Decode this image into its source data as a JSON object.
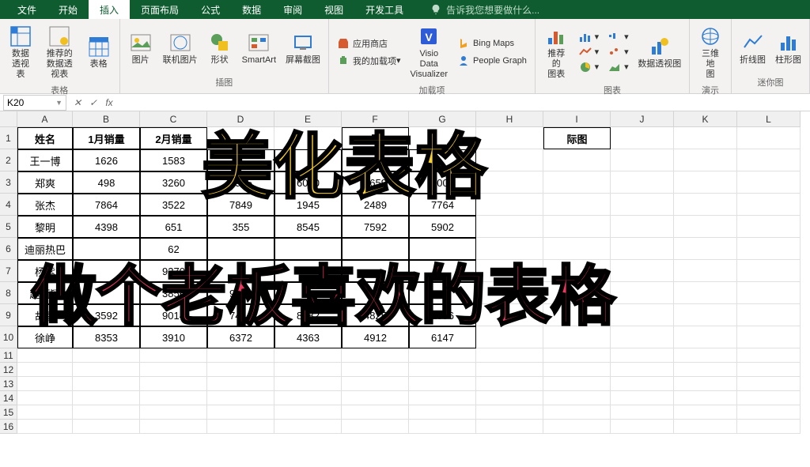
{
  "menu": {
    "file": "文件",
    "home": "开始",
    "insert": "插入",
    "pageLayout": "页面布局",
    "formulas": "公式",
    "data": "数据",
    "review": "审阅",
    "view": "视图",
    "developer": "开发工具",
    "tellMe": "告诉我您想要做什么..."
  },
  "ribbon": {
    "group_tables": "表格",
    "pivotTable": "数据\n透视表",
    "recommendedPivot": "推荐的\n数据透视表",
    "table": "表格",
    "group_illustrations": "插图",
    "picture": "图片",
    "onlinePictures": "联机图片",
    "shapes": "形状",
    "smartArt": "SmartArt",
    "screenshot": "屏幕截图",
    "group_addins": "加载项",
    "store": "应用商店",
    "myAddins": "我的加载项",
    "visioData": "Visio Data\nVisualizer",
    "bingMaps": "Bing Maps",
    "peopleGraph": "People Graph",
    "group_charts": "图表",
    "recommendedCharts": "推荐的\n图表",
    "pivotChart": "数据透视图",
    "group_tours": "演示",
    "map3d": "三维地\n图",
    "group_sparklines": "迷你图",
    "line": "折线图",
    "column": "柱形图"
  },
  "nameBox": "K20",
  "columns": [
    "A",
    "B",
    "C",
    "D",
    "E",
    "F",
    "G",
    "H",
    "I",
    "J",
    "K",
    "L"
  ],
  "colWidths": [
    "col-A",
    "col-B",
    "col-C",
    "col-D",
    "col-E",
    "col-F",
    "col-G",
    "col-H",
    "col-I",
    "col-J",
    "col-K",
    "col-L"
  ],
  "tableHeaders": [
    "姓名",
    "1月销量",
    "2月销量",
    "",
    "",
    "量",
    "",
    "",
    "际图"
  ],
  "tableData": [
    [
      "王一博",
      "1626",
      "1583",
      "",
      "",
      "",
      "",
      "",
      ""
    ],
    [
      "郑爽",
      "498",
      "3260",
      "7965",
      "6030",
      "9659",
      "9004",
      "",
      ""
    ],
    [
      "张杰",
      "7864",
      "3522",
      "7849",
      "1945",
      "2489",
      "7764",
      "",
      ""
    ],
    [
      "黎明",
      "4398",
      "651",
      "355",
      "8545",
      "7592",
      "5902",
      "",
      ""
    ],
    [
      "迪丽热巴",
      "",
      "62",
      "",
      "",
      "",
      "",
      "",
      ""
    ],
    [
      "杨紫",
      "",
      "9270",
      "3",
      "",
      "",
      "",
      "",
      ""
    ],
    [
      "赵丽颖",
      "",
      "3856",
      "9490",
      "",
      "",
      "",
      "",
      ""
    ],
    [
      "胡歌",
      "3592",
      "9014",
      "7444",
      "8082",
      "4825",
      "1096",
      "",
      ""
    ],
    [
      "徐峥",
      "8353",
      "3910",
      "6372",
      "4363",
      "4912",
      "6147",
      "",
      ""
    ]
  ],
  "overlay1": "美化表格",
  "overlay2": "做个老板喜欢的表格"
}
